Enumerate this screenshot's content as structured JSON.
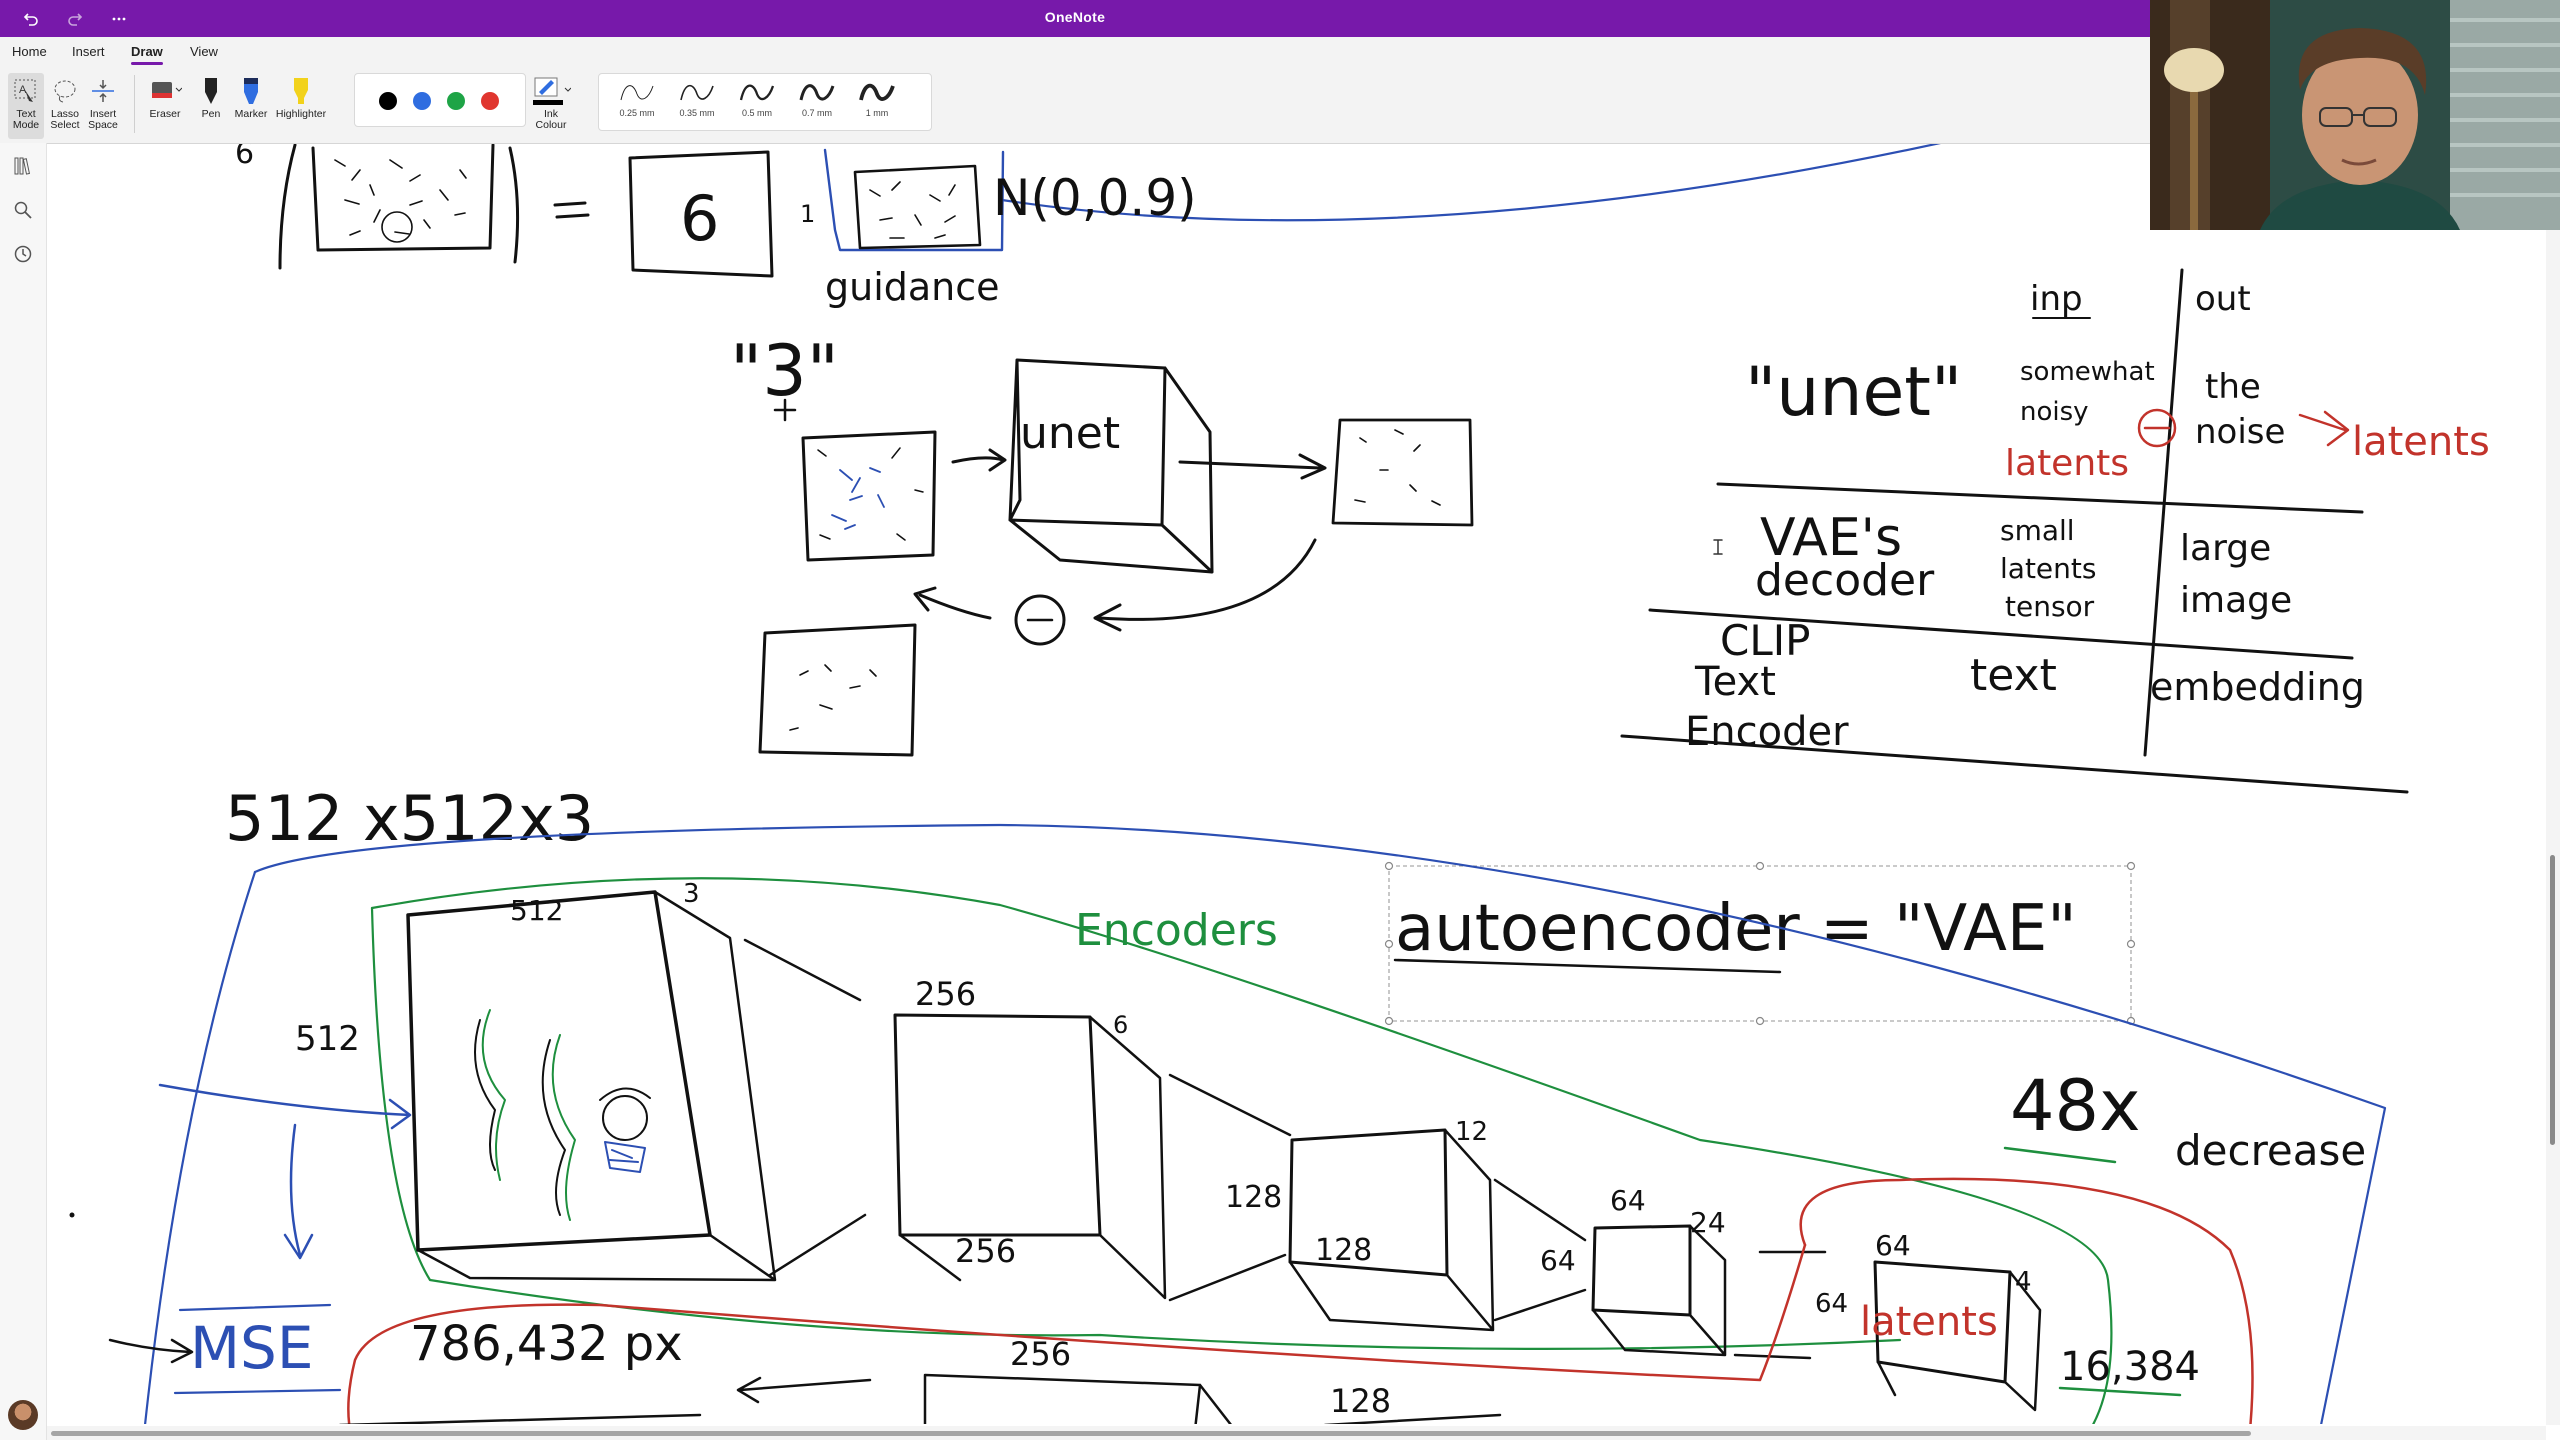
{
  "app": {
    "title": "OneNote"
  },
  "tabs": [
    {
      "label": "Home"
    },
    {
      "label": "Insert"
    },
    {
      "label": "Draw",
      "active": true
    },
    {
      "label": "View"
    }
  ],
  "ribbon": {
    "text_mode": "Text Mode",
    "lasso": "Lasso Select",
    "insert_space": "Insert Space",
    "eraser": "Eraser",
    "pen": "Pen",
    "marker": "Marker",
    "highlighter": "Highlighter",
    "ink_colour": "Ink Colour",
    "colors": [
      "#000000",
      "#2f6de0",
      "#1ea446",
      "#e0362f"
    ],
    "thickness": [
      "0.25 mm",
      "0.35 mm",
      "0.5 mm",
      "0.7 mm",
      "1 mm"
    ]
  },
  "notes": {
    "guidance": "guidance",
    "normal": "N(0,0.9)",
    "six": "6",
    "three": "\"3\"",
    "unet_box": "unet",
    "table": {
      "header_inp": "inp",
      "header_out": "out",
      "unet_name": "\"unet\"",
      "unet_inp": "somewhat noisy latents",
      "unet_out": "the noise",
      "unet_out_extra": "latents",
      "vae_name_1": "VAE's",
      "vae_name_2": "decoder",
      "vae_inp": "small latents tensor",
      "vae_out": "large image",
      "clip_1": "CLIP",
      "clip_2": "Text",
      "clip_3": "Encoder",
      "clip_inp": "text",
      "clip_out": "embedding"
    },
    "dims": "512 x512x3",
    "autoencoder": "autoencoder = \"VAE\"",
    "encoders": "Encoders",
    "decrease": "48x decrease",
    "mse": "MSE",
    "pixels": "786,432 px",
    "latents": "latents",
    "latent_size": "16,384",
    "n512a": "512",
    "n512b": "512",
    "n3": "3",
    "n256a": "256",
    "n256b": "256",
    "n256c": "256",
    "n6": "6",
    "n128a": "128",
    "n128b": "128",
    "n128c": "128",
    "n12": "12",
    "n64a": "64",
    "n64b": "64",
    "n64c": "64",
    "n64d": "64",
    "n24": "24",
    "n4": "4"
  }
}
